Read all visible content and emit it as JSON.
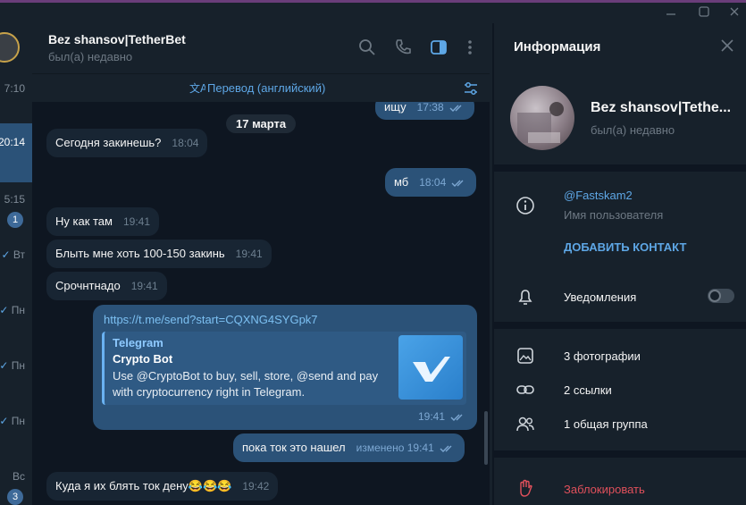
{
  "chat_list": {
    "times": [
      "7:10",
      "20:14",
      "5:15",
      "Вт",
      "Пн",
      "Пн",
      "Пн",
      "Вс"
    ],
    "badges": [
      "1",
      "3"
    ]
  },
  "chat": {
    "title": "Bez shansov|TetherBet",
    "status": "был(а) недавно",
    "translate_label": "Перевод (английский)",
    "date_pill": "17 марта",
    "messages": [
      {
        "dir": "out",
        "text": "ищу",
        "time": "17:38"
      },
      {
        "dir": "in",
        "text": "Сегодня закинешь?",
        "time": "18:04"
      },
      {
        "dir": "out",
        "text": "мб",
        "time": "18:04"
      },
      {
        "dir": "in",
        "text": "Ну как там",
        "time": "19:41"
      },
      {
        "dir": "in",
        "text": "Блыть мне хоть 100-150 закинь",
        "time": "19:41"
      },
      {
        "dir": "in",
        "text": "Срочнтнадо",
        "time": "19:41"
      },
      {
        "dir": "out",
        "text": "пока ток это нашел",
        "time": "изменено 19:41"
      },
      {
        "dir": "in",
        "text": "Куда я их блять ток дену😂😂😂",
        "time": "19:42"
      }
    ],
    "link_message": {
      "url": "https://t.me/send?start=CQXNG4SYGpk7",
      "site": "Telegram",
      "title": "Crypto Bot",
      "description": "Use @CryptoBot to buy, sell, store, @send and pay with cryptocurrency right in Telegram.",
      "time": "19:41"
    }
  },
  "info": {
    "header": "Информация",
    "name": "Bez shansov|Tethe...",
    "status": "был(а) недавно",
    "username": "@Fastskam2",
    "username_label": "Имя пользователя",
    "add_contact": "ДОБАВИТЬ КОНТАКТ",
    "notifications": "Уведомления",
    "notifications_on": false,
    "photos": "3 фотографии",
    "links": "2 ссылки",
    "groups": "1 общая группа",
    "block": "Заблокировать"
  },
  "colors": {
    "accent": "#5ea7e6",
    "outgoing_bubble": "#2b5278",
    "incoming_bubble": "#182533",
    "danger": "#e0505b"
  }
}
